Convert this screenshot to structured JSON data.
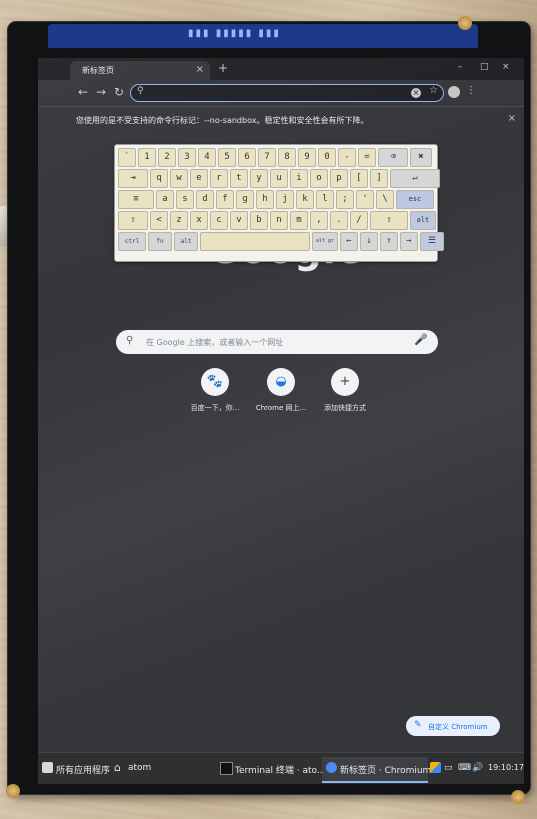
{
  "browser": {
    "tab_title": "新标签页",
    "tab_close": "×",
    "new_tab": "+",
    "omnibox_search_glyph": "⚲",
    "window_controls": [
      "–",
      "□",
      "×"
    ],
    "infobar_message": "您使用的是不受支持的命令行标记：--no-sandbox。稳定性和安全性会有所下降。",
    "infobar_close": "×"
  },
  "page": {
    "logo": "Google",
    "search_placeholder": "在 Google 上搜索，或者输入一个网址",
    "shortcuts": [
      {
        "label": "百度一下，你...",
        "icon": "baidu-paw-icon",
        "glyph": "🐾"
      },
      {
        "label": "Chrome 网上...",
        "icon": "chrome-web-store-icon",
        "glyph": "◒"
      },
      {
        "label": "添加快捷方式",
        "icon": "plus-icon",
        "glyph": "+"
      }
    ],
    "customize_label": "自定义 Chromium"
  },
  "keyboard": {
    "rows": [
      [
        "`",
        "1",
        "2",
        "3",
        "4",
        "5",
        "6",
        "7",
        "8",
        "9",
        "0",
        "-",
        "=",
        "⌫",
        "✖"
      ],
      [
        "⇥",
        "q",
        "w",
        "e",
        "r",
        "t",
        "y",
        "u",
        "i",
        "o",
        "p",
        "[",
        "]",
        "↵"
      ],
      [
        "≡",
        "a",
        "s",
        "d",
        "f",
        "g",
        "h",
        "j",
        "k",
        "l",
        ";",
        "'",
        "\\",
        "esc"
      ],
      [
        "⇧",
        "<",
        "z",
        "x",
        "c",
        "v",
        "b",
        "n",
        "m",
        ",",
        ".",
        "/",
        "⇧",
        "alt"
      ],
      [
        "ctrl",
        "fn",
        "alt",
        "space",
        "alt gr",
        "←",
        "↓",
        "↑",
        "→",
        "☰"
      ]
    ]
  },
  "taskbar": {
    "apps_menu": "所有应用程序",
    "home_label": "atom",
    "task_terminal": "Terminal 终端 · ato...",
    "task_chromium": "新标签页 · Chromium",
    "clock": "19:10:17"
  },
  "colors": {
    "screen_bg": "#35363a",
    "accent": "#8ab4f8",
    "key_bg": "#e9e3c3"
  }
}
